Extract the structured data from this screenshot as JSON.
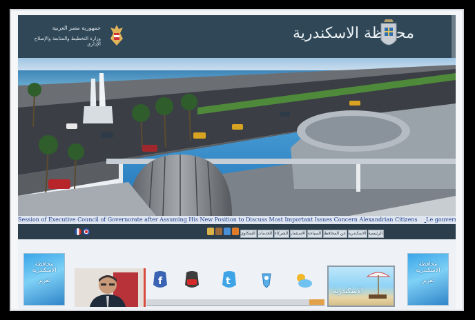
{
  "header": {
    "title": "محافظة الاسكندرية",
    "ministry_line1": "جمهورية مصر العربية",
    "ministry_line2": "وزارة التخطيط والمتابعة والإصلاح الإداري"
  },
  "ticker": {
    "items": [
      "Session of Executive Council of Governorate after Assuming His New Position to Discuss Most Important Issues Concern Alexandrian Citizens",
      "Le gouverneur d'Alexandrie préside la première séance du comité exécutif au gouverneur"
    ]
  },
  "nav": {
    "menu_items": [
      "الرئيسية",
      "الاسكندرية",
      "عن المحافظة",
      "السياحة",
      "الاستثمار",
      "الشركاء",
      "الخدمات",
      "الشكاوي"
    ]
  },
  "banners": {
    "left_line1": "محافظة الاسكندرية",
    "left_line2": "تقرير",
    "right_line1": "محافظة الاسكندرية",
    "right_line2": "تقرير"
  },
  "promo": {
    "label": "الاسكندرية"
  },
  "colors": {
    "header": "#2f4757",
    "navbar": "#2c3e4c",
    "ticker_text": "#1b3d8f"
  }
}
